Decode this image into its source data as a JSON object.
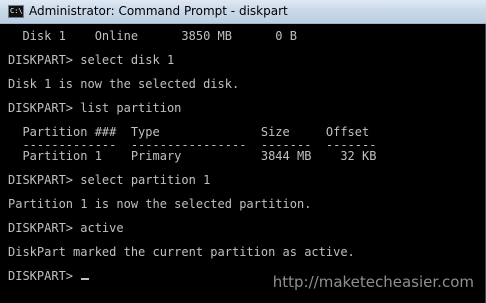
{
  "window": {
    "title": "Administrator: Command Prompt - diskpart",
    "icon_text": "C:\\"
  },
  "console": {
    "lines": [
      "  Disk 1    Online      3850 MB      0 B",
      "DISKPART> select disk 1",
      "Disk 1 is now the selected disk.",
      "DISKPART> list partition",
      "  Partition ###  Type              Size     Offset",
      "  -------------  ----------------  -------  -------",
      "  Partition 1    Primary           3844 MB    32 KB",
      "DISKPART> select partition 1",
      "Partition 1 is now the selected partition.",
      "DISKPART> active",
      "DiskPart marked the current partition as active.",
      "DISKPART> "
    ]
  },
  "watermark": "http://maketecheasier.com",
  "colors": {
    "console_background": "#000000",
    "console_text": "#c0c0c0",
    "titlebar": "#c9d9e9"
  }
}
